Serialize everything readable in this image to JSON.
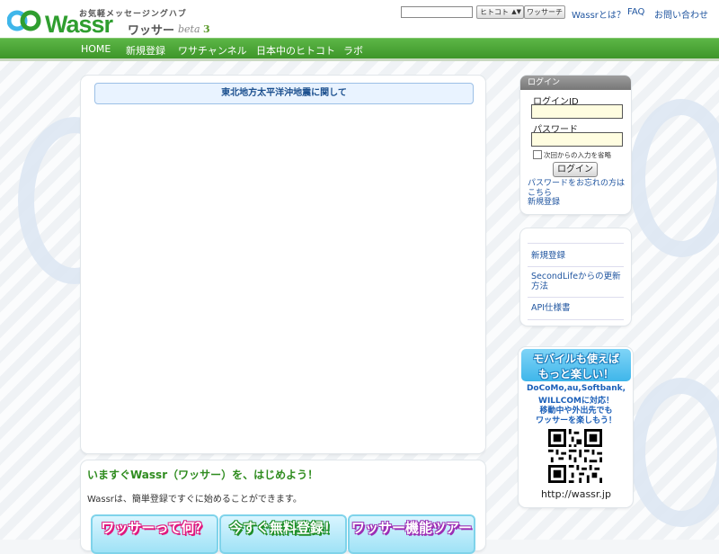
{
  "brand": {
    "tagline": "お気軽メッセージングハブ",
    "wordmark": "Wassr",
    "kana": "ワッサー",
    "beta_label": "beta",
    "beta_version": "3",
    "accent": "#3c9428"
  },
  "search": {
    "input_value": "",
    "select_value": "ヒトコト",
    "button_label": "ワッサーチ"
  },
  "top_links": [
    "Wassrとは？",
    "FAQ",
    "お問い合わせ"
  ],
  "nav": [
    "HOME",
    "新規登録",
    "ワサチャンネル",
    "日本中のヒトコト",
    "ラボ"
  ],
  "notice": "東北地方太平洋沖地震に関して",
  "intro": {
    "title": "いますぐWassr（ワッサー）を、はじめよう！",
    "text": "Wassrは、簡単登録ですぐに始めることができます。",
    "buttons": [
      "ワッサーって何？",
      "今すぐ無料登録！",
      "ワッサー機能ツアー"
    ]
  },
  "login": {
    "header": "ログイン",
    "id_label": "ログインID",
    "password_label": "パスワード",
    "remember_label": "次回からの入力を省略",
    "button_label": "ログイン",
    "forgot_link": "パスワードをお忘れの方はこちら",
    "register_link": "新規登録"
  },
  "side_menu": [
    "新規登録",
    "SecondLifeからの更新方法",
    "API仕様書"
  ],
  "mobile": {
    "title_line1": "モバイルも使えば",
    "title_line2": "もっと楽しい！",
    "carriers": "DoCoMo,au,Softbank,",
    "carriers2": "WILLCOMに対応！",
    "line3": "移動中や外出先でも",
    "line4": "ワッサーを楽しもう！",
    "url": "http://wassr.jp",
    "qr_icon": "qr-code-icon"
  }
}
